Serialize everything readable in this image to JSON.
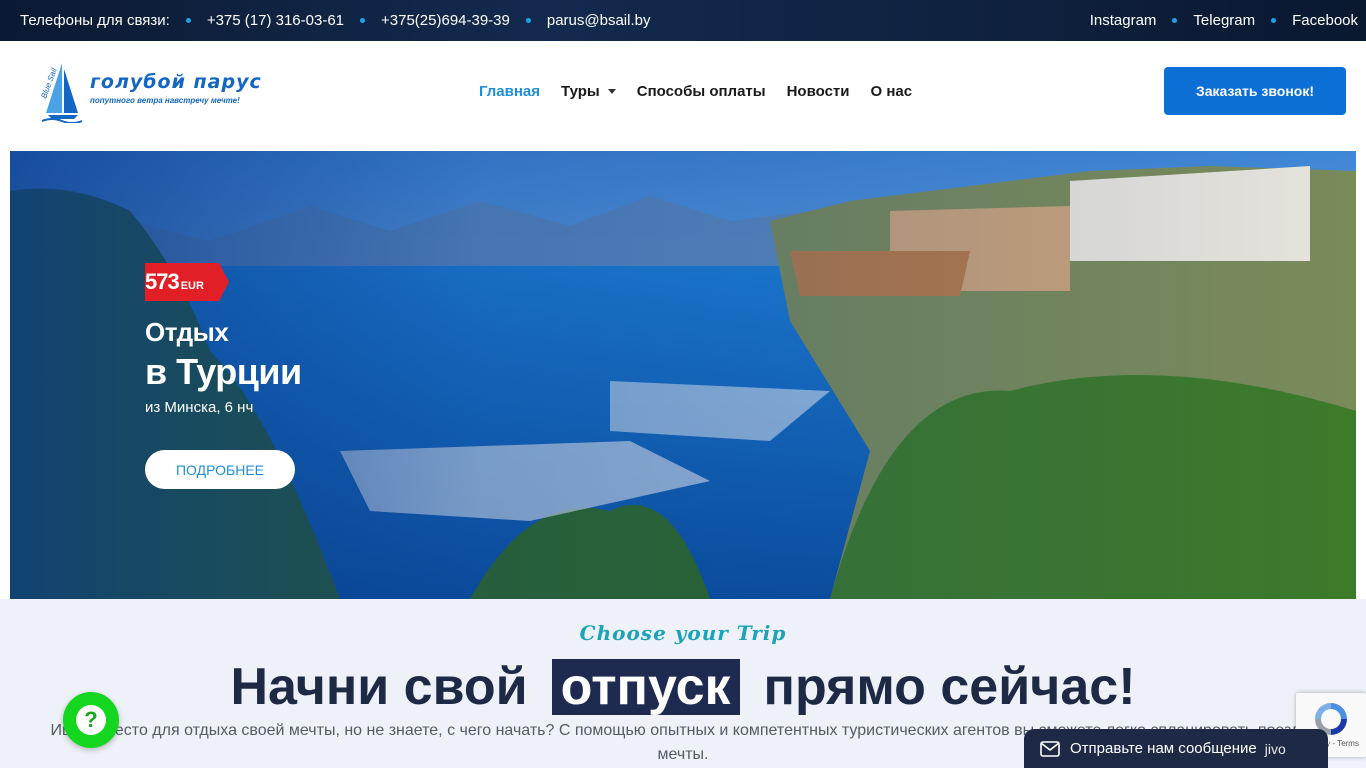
{
  "topbar": {
    "contacts_label": "Телефоны для связи:",
    "phone1": "+375 (17) 316-03-61",
    "phone2": "+375(25)694-39-39",
    "email": "parus@bsail.by",
    "socials": [
      "Instagram",
      "Telegram",
      "Facebook"
    ]
  },
  "logo": {
    "name": "голубой парус",
    "tagline": "попутного ветра навстречу мечте!",
    "mark_text": "Blue Sail"
  },
  "nav": {
    "items": [
      {
        "label": "Главная",
        "active": true
      },
      {
        "label": "Туры",
        "has_dropdown": true
      },
      {
        "label": "Способы оплаты"
      },
      {
        "label": "Новости"
      },
      {
        "label": "О нас"
      }
    ]
  },
  "cta": {
    "label": "Заказать звонок!"
  },
  "hero": {
    "price_value": "573",
    "price_currency": "EUR",
    "line1": "Отдых",
    "line2": "в Турции",
    "line3": "из Минска, 6 нч",
    "button_label": "ПОДРОБНЕЕ"
  },
  "intro": {
    "eyebrow": "Choose your Trip",
    "headline_before": "Начни свой",
    "headline_highlight": "отпуск",
    "headline_after": "прямо сейчас!",
    "paragraph": "Ищете место для отдыха своей мечты, но не знаете, с чего начать? С помощью опытных и компетентных туристических агентов вы сможете легко спланировать поездку мечты."
  },
  "widgets": {
    "help_icon": "question-icon",
    "recaptcha_terms": "Privacy - Terms",
    "chat_label": "Отправьте нам сообщение",
    "chat_brand": "jivo"
  },
  "colors": {
    "accent": "#1d8fd6",
    "cta": "#0b6fd6",
    "price_tag": "#e21f26",
    "dark_navy": "#1e2a45",
    "help_green": "#14d61e"
  }
}
